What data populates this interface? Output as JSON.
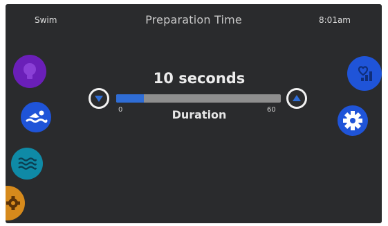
{
  "header": {
    "mode": "Swim",
    "title": "Preparation Time",
    "time": "8:01am"
  },
  "setting": {
    "value_text": "10 seconds",
    "label": "Duration",
    "min_label": "0",
    "max_label": "60",
    "min": 0,
    "max": 60,
    "value": 10
  },
  "colors": {
    "accent": "#1f54d8",
    "slider_fill": "#2f6dd6",
    "track": "#8e8e8e",
    "background": "#2a2b2d",
    "light_button": "#6a1fb8",
    "wave_button": "#0f8aa6",
    "heater_button": "#d68a1c"
  },
  "icons": {
    "left_rail": [
      "lightbulb-icon",
      "swimmer-icon",
      "waves-icon",
      "gear-icon"
    ],
    "right_rail": [
      "heart-stats-icon",
      "gear-icon"
    ],
    "stepper": [
      "triangle-down-icon",
      "triangle-up-icon"
    ]
  }
}
